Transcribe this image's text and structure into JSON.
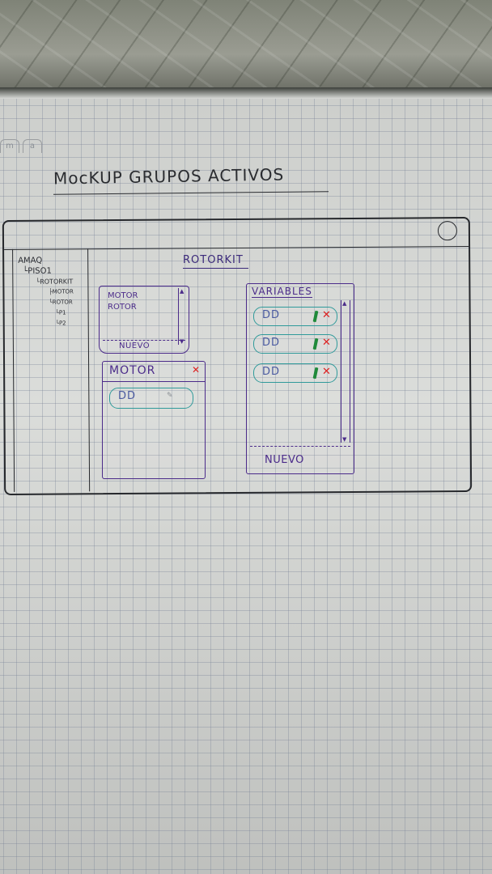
{
  "sketch": {
    "title": "MocKUP GRUPOS ACTIVOS",
    "tabs": [
      "m",
      "a"
    ]
  },
  "sidebar": {
    "tree": [
      {
        "label": "AMAQ",
        "level": 0
      },
      {
        "label": "PISO1",
        "level": 1
      },
      {
        "label": "ROTORKIT",
        "level": 2
      },
      {
        "label": "MOTOR",
        "level": 3
      },
      {
        "label": "ROTOR",
        "level": 3
      },
      {
        "label": "P1",
        "level": 4
      },
      {
        "label": "P2",
        "level": 4
      }
    ]
  },
  "main": {
    "heading": "ROTORKIT",
    "group_list": {
      "items": [
        "MOTOR",
        "ROTOR"
      ],
      "new_label": "NUEVO"
    },
    "motor_panel": {
      "title": "MOTOR",
      "close_icon": "x-icon",
      "field_value": "DD"
    },
    "variables_panel": {
      "title": "VARIABLES",
      "items": [
        {
          "value": "DD",
          "edit_icon": "pencil-icon",
          "delete_icon": "x-icon"
        },
        {
          "value": "DD",
          "edit_icon": "pencil-icon",
          "delete_icon": "x-icon"
        },
        {
          "value": "DD",
          "edit_icon": "pencil-icon",
          "delete_icon": "x-icon"
        }
      ],
      "new_label": "NUEVO"
    }
  },
  "colors": {
    "ink": "#26282c",
    "purple_pen": "#4b2b8a",
    "teal_pen": "#2f9a9a",
    "red_pen": "#d22222",
    "green_pen": "#1f8a3a"
  }
}
